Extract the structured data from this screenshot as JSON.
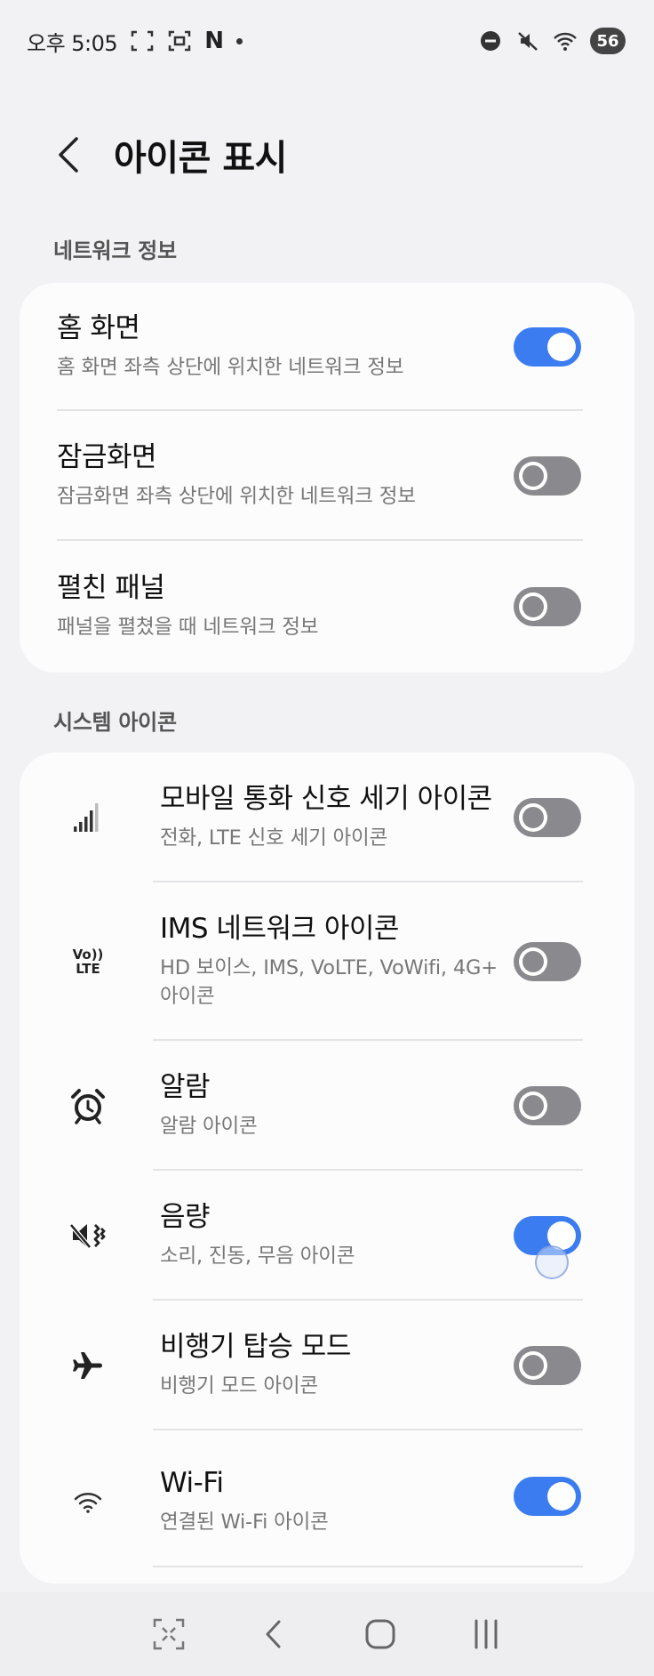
{
  "status_bar": {
    "time": "오후 5:05",
    "notif_letter": "N",
    "battery": "56"
  },
  "header": {
    "title": "아이콘 표시"
  },
  "network_section": {
    "label": "네트워크 정보",
    "items": [
      {
        "title": "홈 화면",
        "subtitle": "홈 화면 좌측 상단에 위치한 네트워크 정보",
        "enabled": true
      },
      {
        "title": "잠금화면",
        "subtitle": "잠금화면 좌측 상단에 위치한 네트워크 정보",
        "enabled": false
      },
      {
        "title": "펼친 패널",
        "subtitle": "패널을 펼쳤을 때 네트워크 정보",
        "enabled": false
      }
    ]
  },
  "system_section": {
    "label": "시스템 아이콘",
    "items": [
      {
        "icon": "signal-strength-icon",
        "title": "모바일 통화 신호 세기 아이콘",
        "subtitle": "전화, LTE 신호 세기 아이콘",
        "enabled": false
      },
      {
        "icon": "volte-icon",
        "icon_text_top": "Vo))",
        "icon_text_bottom": "LTE",
        "title": "IMS 네트워크 아이콘",
        "subtitle": "HD 보이스, IMS, VoLTE, VoWifi, 4G+ 아이콘",
        "enabled": false
      },
      {
        "icon": "alarm-clock-icon",
        "title": "알람",
        "subtitle": "알람 아이콘",
        "enabled": false
      },
      {
        "icon": "vibrate-mute-icon",
        "title": "음량",
        "subtitle": "소리, 진동, 무음 아이콘",
        "enabled": true
      },
      {
        "icon": "airplane-icon",
        "title": "비행기 탑승 모드",
        "subtitle": "비행기 모드 아이콘",
        "enabled": false
      },
      {
        "icon": "wifi-icon",
        "title": "Wi-Fi",
        "subtitle": "연결된 Wi-Fi 아이콘",
        "enabled": true
      }
    ]
  },
  "colors": {
    "toggle_on": "#3b7cf0",
    "toggle_off": "#8a8a8e",
    "background": "#f2f2f4",
    "card": "#fcfcfd"
  }
}
